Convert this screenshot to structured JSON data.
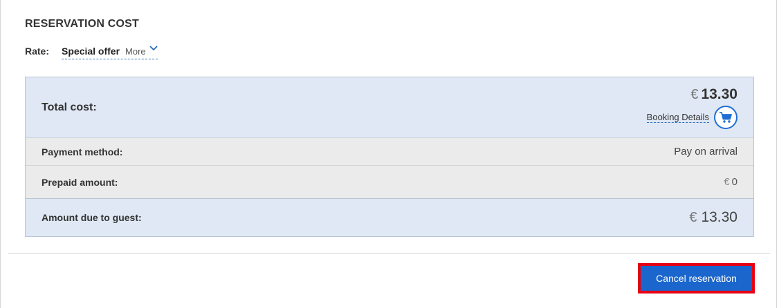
{
  "section": {
    "title": "RESERVATION COST"
  },
  "rate": {
    "label": "Rate:",
    "value": "Special offer",
    "more_label": "More"
  },
  "cost": {
    "total": {
      "label": "Total cost:",
      "currency": "€",
      "amount": "13.30",
      "booking_details_label": "Booking Details"
    },
    "payment_method": {
      "label": "Payment method:",
      "value": "Pay on arrival"
    },
    "prepaid": {
      "label": "Prepaid amount:",
      "currency": "€",
      "amount": "0"
    },
    "due": {
      "label": "Amount due to guest:",
      "currency": "€",
      "amount": "13.30"
    }
  },
  "actions": {
    "cancel_label": "Cancel reservation"
  },
  "icons": {
    "more": "chevron-down-icon",
    "booking": "cart-icon"
  },
  "colors": {
    "accent": "#1b66cc",
    "highlight_border": "#e60012",
    "row_blue": "#dfe8f4",
    "row_gray": "#ebebeb"
  }
}
